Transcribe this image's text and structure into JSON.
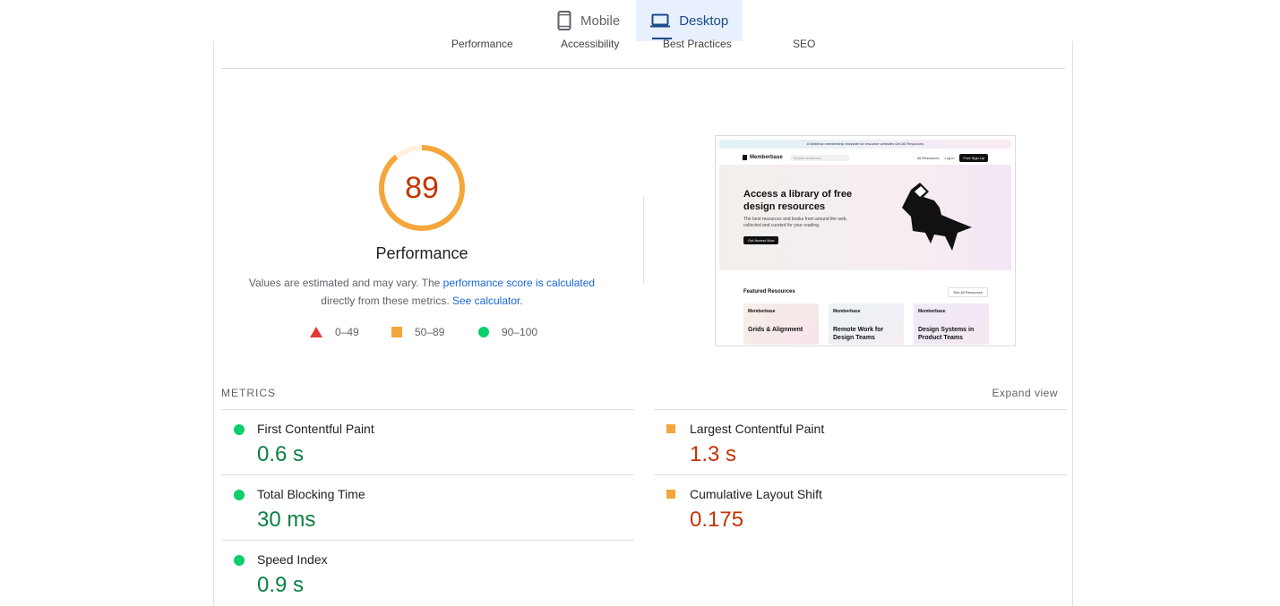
{
  "device_tabs": [
    {
      "label": "Mobile",
      "icon": "mobile-phone-icon",
      "active": false
    },
    {
      "label": "Desktop",
      "icon": "laptop-icon",
      "active": true
    }
  ],
  "category_tabs": [
    "Performance",
    "Accessibility",
    "Best Practices",
    "SEO"
  ],
  "gauge": {
    "score": "89",
    "score_value": 89,
    "title": "Performance",
    "color": "#f4a63b",
    "score_color": "#c33300"
  },
  "description": {
    "text_before": "Values are estimated and may vary. The ",
    "link1": "performance score is calculated",
    "text_mid": "directly from these metrics. ",
    "link2": "See calculator."
  },
  "legend": [
    {
      "range": "0–49",
      "shape": "triangle",
      "color": "#e53935"
    },
    {
      "range": "50–89",
      "shape": "square",
      "color": "#f4a63b"
    },
    {
      "range": "90–100",
      "shape": "circle",
      "color": "#0cce6b"
    }
  ],
  "screenshot": {
    "banner": "A Webflow membership template for resource websites   Get All Resources",
    "logo": "Memberbase",
    "search_placeholder": "Search resources",
    "nav_link1": "All Resources",
    "nav_link2": "Log in",
    "signup": "Free Sign Up",
    "hero_title": "Access a library of free design resources",
    "hero_text": "The best resources and books from around the web, collected and curated for your reading.",
    "hero_button": "Get Access Now",
    "featured_title": "Featured Resources",
    "featured_button": "See All Resources",
    "cards": [
      {
        "logo": "Memberbase",
        "title": "Grids & Alignment"
      },
      {
        "logo": "Memberbase",
        "title": "Remote Work for Design Teams"
      },
      {
        "logo": "Memberbase",
        "title": "Design Systems in Product Teams"
      }
    ]
  },
  "metrics_section": {
    "label": "METRICS",
    "expand": "Expand view",
    "items": [
      {
        "name": "First Contentful Paint",
        "value": "0.6 s",
        "rating": "good"
      },
      {
        "name": "Largest Contentful Paint",
        "value": "1.3 s",
        "rating": "average"
      },
      {
        "name": "Total Blocking Time",
        "value": "30 ms",
        "rating": "good"
      },
      {
        "name": "Cumulative Layout Shift",
        "value": "0.175",
        "rating": "average"
      },
      {
        "name": "Speed Index",
        "value": "0.9 s",
        "rating": "good"
      }
    ]
  },
  "colors": {
    "good": "#0cce6b",
    "good_text": "#0b8043",
    "average": "#f4a63b",
    "average_text": "#c33300",
    "fail": "#e53935",
    "link": "#1967d2",
    "active_tab_bg": "#e8f0fe"
  }
}
